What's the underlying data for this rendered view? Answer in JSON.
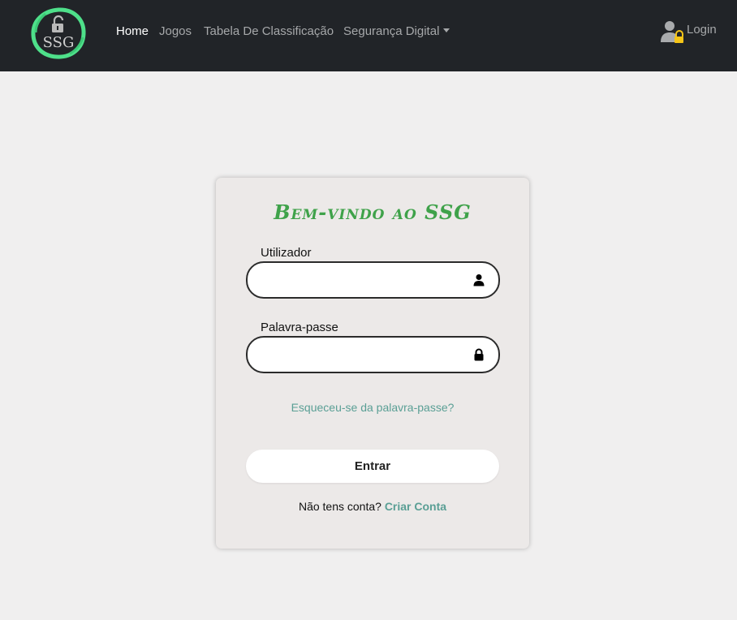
{
  "header": {
    "logo_text": "SSG",
    "nav": [
      {
        "label": "Home",
        "active": true
      },
      {
        "label": "Jogos",
        "active": false
      },
      {
        "label": "Tabela De Classificação",
        "active": false
      },
      {
        "label": "Segurança Digital",
        "active": false,
        "dropdown": true
      }
    ],
    "login_label": "Login",
    "login_icon": "user-lock-icon"
  },
  "login_card": {
    "title": "Bem-vindo ao SSG",
    "username_label": "Utilizador",
    "username_value": "",
    "username_icon": "user-icon",
    "password_label": "Palavra-passe",
    "password_value": "",
    "password_icon": "lock-icon",
    "forgot_link": "Esqueceu-se da palavra-passe?",
    "submit_label": "Entrar",
    "signup_prompt": "Não tens conta?",
    "signup_link": "Criar Conta"
  },
  "colors": {
    "navbar_bg": "#212428",
    "page_bg": "#f0efef",
    "card_bg": "#ece9e8",
    "title_green": "#3fa24a",
    "link_teal": "#5a9f95",
    "logo_ring": "#4ee08a",
    "lock_yellow": "#f5c518"
  }
}
